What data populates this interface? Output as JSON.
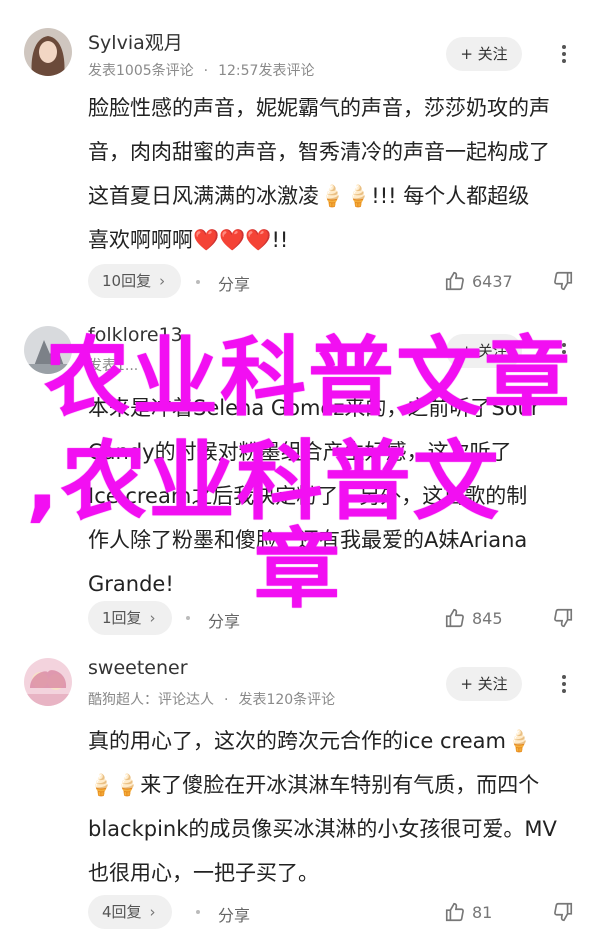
{
  "comments": [
    {
      "username": "Sylvia观月",
      "meta_left": "发表1005条评论",
      "meta_right": "12:57发表评论",
      "follow_label": "+ 关注",
      "lines": [
        "脸脸性感的声音，妮妮霸气的声音，莎莎奶攻的声",
        "音，肉肉甜蜜的声音，智秀清冷的声音一起构成了",
        "这首夏日风满满的冰激凌🍦🍦!!! 每个人都超级",
        "喜欢啊啊啊❤️❤️❤️!!"
      ],
      "reply_label": "10回复",
      "share_label": "分享",
      "likes": "6437",
      "avatar_color": "#6b4a3a"
    },
    {
      "username": "folklore13",
      "meta_left": "发表1...",
      "meta_right": "",
      "follow_label": "+ 关注",
      "lines": [
        "本来是冲着Selena Gomez来的，之前听了Sour",
        "Candy的时候对粉墨组合产生好感，这次听了",
        "Ice cream之后我决定粉了，另外，这首歌的制",
        "作人除了粉墨和傻脸，还有我最爱的A妹Ariana",
        "Grande!"
      ],
      "reply_label": "1回复",
      "share_label": "分享",
      "likes": "845",
      "avatar_color": "#8a8f96"
    },
    {
      "username": "sweetener",
      "meta_left": "酷狗超人：评论达人",
      "meta_right": "发表120条评论",
      "follow_label": "+ 关注",
      "lines": [
        "真的用心了，这次的跨次元合作的ice cream🍦",
        "🍦🍦来了傻脸在开冰淇淋车特别有气质，而四个",
        "blackpink的成员像买冰淇淋的小女孩很可爱。MV",
        "也很用心，一把子买了。"
      ],
      "reply_label": "4回复",
      "share_label": "分享",
      "likes": "81",
      "avatar_color": "#e8b4c4"
    }
  ],
  "watermark": {
    "line1": "农业科普文章",
    "line2": ",农业科普文",
    "line3": "章",
    "color": "#f20ff2"
  }
}
